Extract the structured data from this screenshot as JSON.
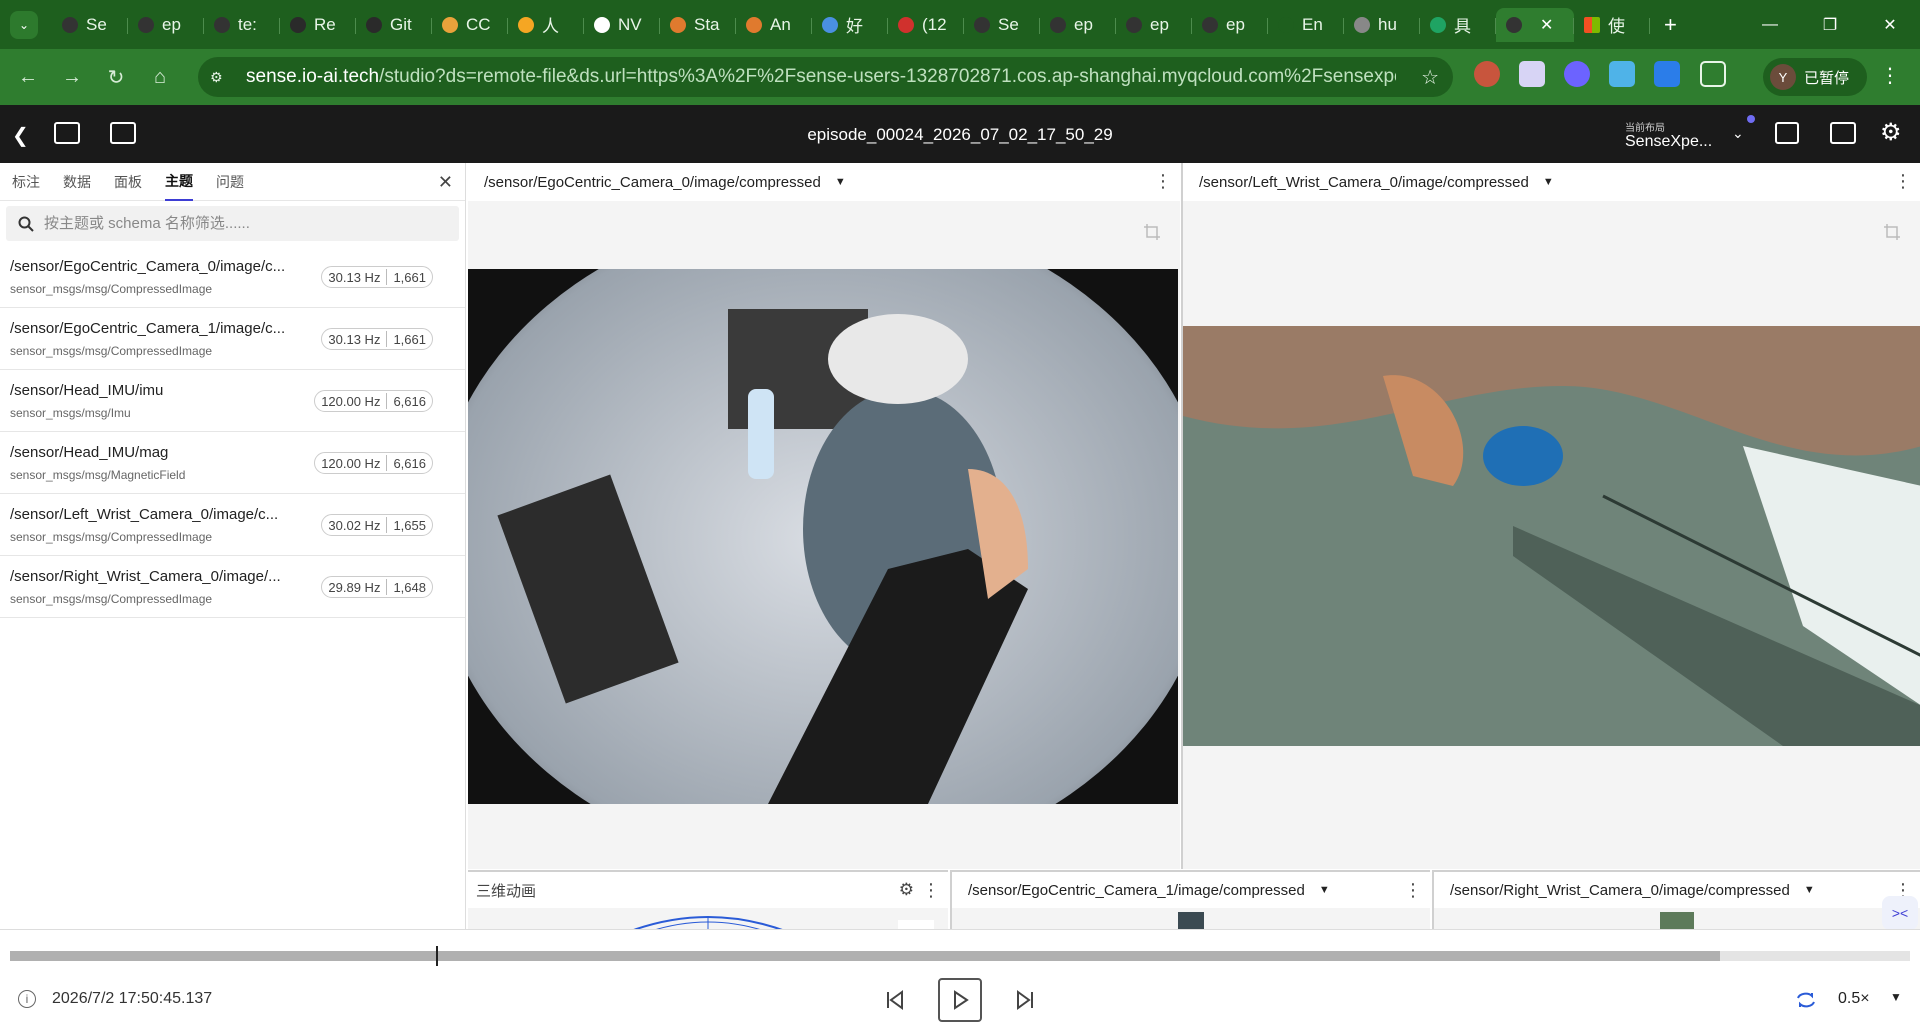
{
  "browser": {
    "tabs": [
      {
        "label": "Se",
        "color": "#333"
      },
      {
        "label": "ep",
        "color": "#333"
      },
      {
        "label": "te:",
        "color": "#333"
      },
      {
        "label": "Re",
        "color": "#2a2a2a"
      },
      {
        "label": "Git",
        "color": "#2a2a2a"
      },
      {
        "label": "CC",
        "color": "#e9a23b"
      },
      {
        "label": "人",
        "color": "#f5a623"
      },
      {
        "label": "NV",
        "color": "#ffffff"
      },
      {
        "label": "Sta",
        "color": "#e07a2e"
      },
      {
        "label": "An",
        "color": "#e07a2e"
      },
      {
        "label": "好",
        "color": "#4a90e2"
      },
      {
        "label": "(12",
        "color": "#d0312d"
      },
      {
        "label": "Se",
        "color": "#333"
      },
      {
        "label": "ep",
        "color": "#333"
      },
      {
        "label": "ep",
        "color": "#333"
      },
      {
        "label": "ep",
        "color": "#333"
      },
      {
        "label": "En",
        "color": "#1e5f1e"
      },
      {
        "label": "hu",
        "color": "#888"
      },
      {
        "label": "具",
        "color": "#1fa463"
      }
    ],
    "active_tab": {
      "label": "",
      "close": "✕"
    },
    "last_tab": {
      "label": "使"
    },
    "new_tab": "+",
    "url_host": "sense.io-ai.tech",
    "url_rest": "/studio?ds=remote-file&ds.url=https%3A%2F%2Fsense-users-1328702871.cos.ap-shanghai.myqcloud.com%2Fsensexpe...",
    "profile_initial": "Y",
    "profile_status": "已暂停"
  },
  "app": {
    "title": "episode_00024_2026_07_02_17_50_29",
    "layout_label": "当前布局",
    "layout_value": "SenseXpe...",
    "accent": "#3d3dd4"
  },
  "sidebar": {
    "tabs": [
      "标注",
      "数据",
      "面板",
      "主题",
      "问题"
    ],
    "active_tab": "主题",
    "filter_placeholder": "按主题或 schema 名称筛选......",
    "topics": [
      {
        "name": "/sensor/EgoCentric_Camera_0/image/c...",
        "schema": "sensor_msgs/msg/CompressedImage",
        "hz": "30.13 Hz",
        "count": "1,661"
      },
      {
        "name": "/sensor/EgoCentric_Camera_1/image/c...",
        "schema": "sensor_msgs/msg/CompressedImage",
        "hz": "30.13 Hz",
        "count": "1,661"
      },
      {
        "name": "/sensor/Head_IMU/imu",
        "schema": "sensor_msgs/msg/Imu",
        "hz": "120.00 Hz",
        "count": "6,616"
      },
      {
        "name": "/sensor/Head_IMU/mag",
        "schema": "sensor_msgs/msg/MagneticField",
        "hz": "120.00 Hz",
        "count": "6,616"
      },
      {
        "name": "/sensor/Left_Wrist_Camera_0/image/c...",
        "schema": "sensor_msgs/msg/CompressedImage",
        "hz": "30.02 Hz",
        "count": "1,655"
      },
      {
        "name": "/sensor/Right_Wrist_Camera_0/image/...",
        "schema": "sensor_msgs/msg/CompressedImage",
        "hz": "29.89 Hz",
        "count": "1,648"
      }
    ]
  },
  "panels": {
    "ego0": "/sensor/EgoCentric_Camera_0/image/compressed",
    "left_wrist": "/sensor/Left_Wrist_Camera_0/image/compressed",
    "three_d": "三维动画",
    "ego1": "/sensor/EgoCentric_Camera_1/image/compressed",
    "right_wrist": "/sensor/Right_Wrist_Camera_0/image/compressed"
  },
  "playback": {
    "timestamp": "2026/7/2 17:50:45.137",
    "speed": "0.5×",
    "progress": 0.224,
    "buffered": 0.9
  }
}
